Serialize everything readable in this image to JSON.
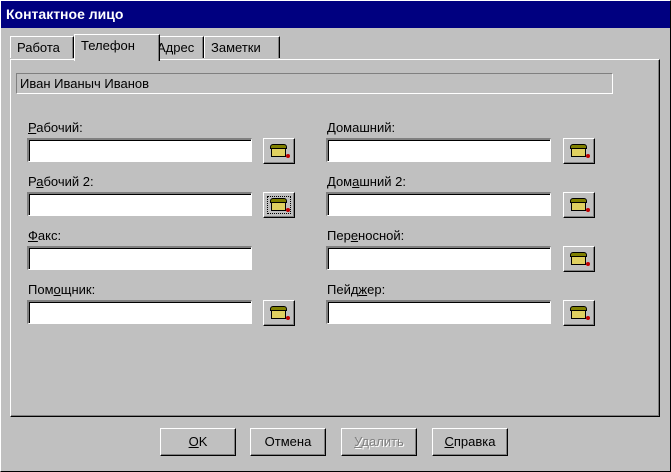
{
  "window": {
    "title": "Контактное лицо"
  },
  "tabs": [
    {
      "label": "Работа",
      "active": false
    },
    {
      "label": "Телефон",
      "active": true
    },
    {
      "label": "Адрес",
      "active": false
    },
    {
      "label": "Заметки",
      "active": false
    }
  ],
  "contact_name": "Иван Иваныч Иванов",
  "fields": {
    "work": {
      "label_first": "Р",
      "label_rest": "абочий:",
      "value": ""
    },
    "work2": {
      "label_pre": "Р",
      "label_u": "а",
      "label_rest": "бочий 2:",
      "value": ""
    },
    "fax": {
      "label_u": "Ф",
      "label_rest": "акс:",
      "value": ""
    },
    "assistant": {
      "label_pre": "Пом",
      "label_u": "о",
      "label_rest": "щник:",
      "value": ""
    },
    "home": {
      "label_u": "Д",
      "label_rest": "омашний:",
      "value": ""
    },
    "home2": {
      "label_pre": "Дом",
      "label_u": "а",
      "label_rest": "шний 2:",
      "value": ""
    },
    "mobile": {
      "label_pre": "Пер",
      "label_u": "е",
      "label_rest": "носной:",
      "value": ""
    },
    "pager": {
      "label_pre": "Пейд",
      "label_u": "ж",
      "label_rest": "ер:",
      "value": ""
    }
  },
  "icons": {
    "dial": "phone-dial-icon"
  },
  "buttons": {
    "ok": {
      "u": "О",
      "rest": "K"
    },
    "cancel": "Отмена",
    "delete": {
      "u": "У",
      "rest": "далить",
      "disabled": true
    },
    "help": {
      "u": "С",
      "rest": "правка"
    }
  }
}
